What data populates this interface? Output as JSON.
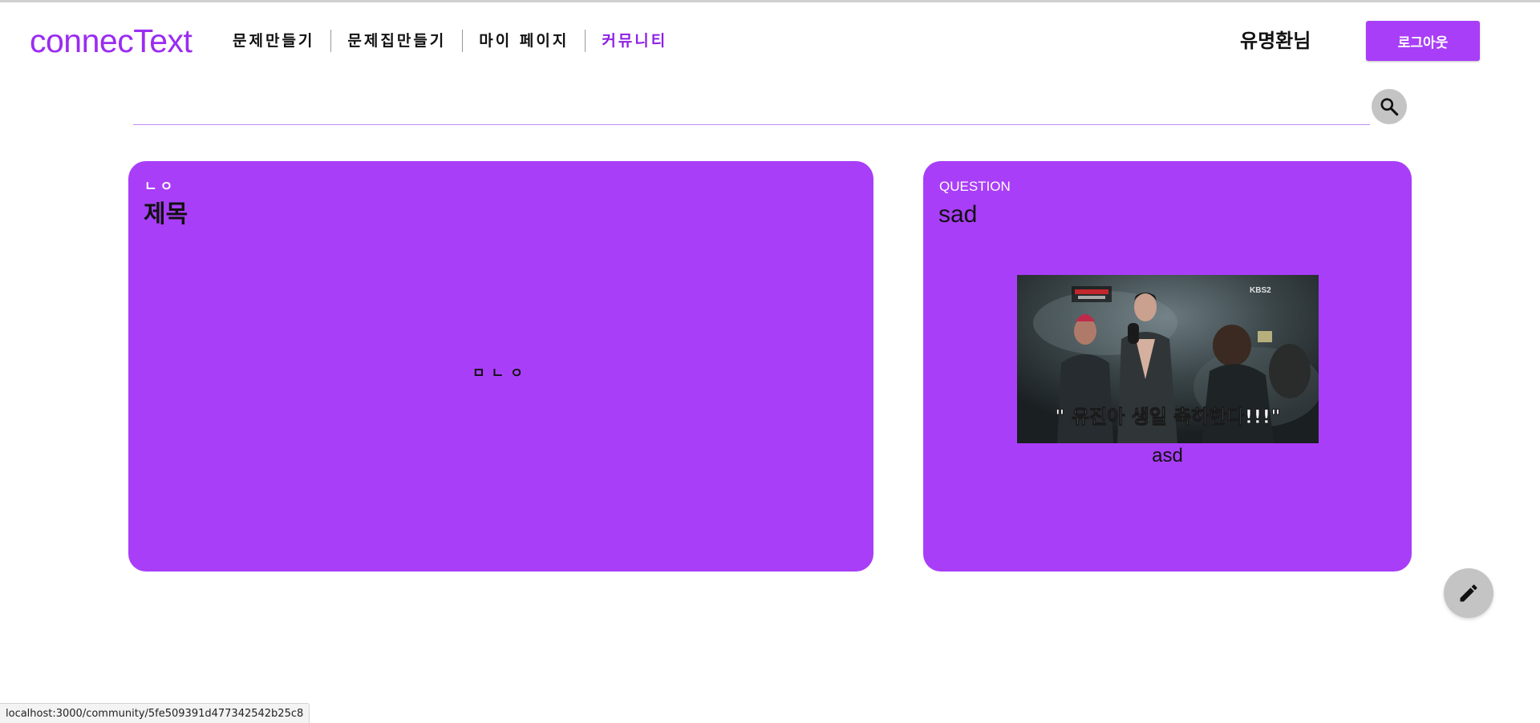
{
  "header": {
    "logo": "connecText",
    "nav": [
      {
        "label": "문제만들기"
      },
      {
        "label": "문제집만들기"
      },
      {
        "label": "마이 페이지"
      },
      {
        "label": "커뮤니티"
      }
    ],
    "username": "유명환님",
    "logout_label": "로그아웃"
  },
  "search": {
    "placeholder": "",
    "value": ""
  },
  "posts": [
    {
      "category": "ㄴㅇ",
      "title": "제목",
      "body": "ㅁㄴㅇ"
    },
    {
      "category": "QUESTION",
      "title": "sad",
      "image_caption": "\" 유진아 생일 축하한다!!!\"",
      "image_logo": "KBS2",
      "body": "asd"
    }
  ],
  "status_bar": {
    "url": "localhost:3000/community/5fe509391d477342542b25c8"
  },
  "colors": {
    "accent": "#a93ef8",
    "logo": "#9b2cf0",
    "active_nav": "#8e1fe6",
    "icon_button_bg": "#c4c4c4"
  },
  "icons": {
    "search": "search-icon",
    "edit": "pencil-icon"
  }
}
